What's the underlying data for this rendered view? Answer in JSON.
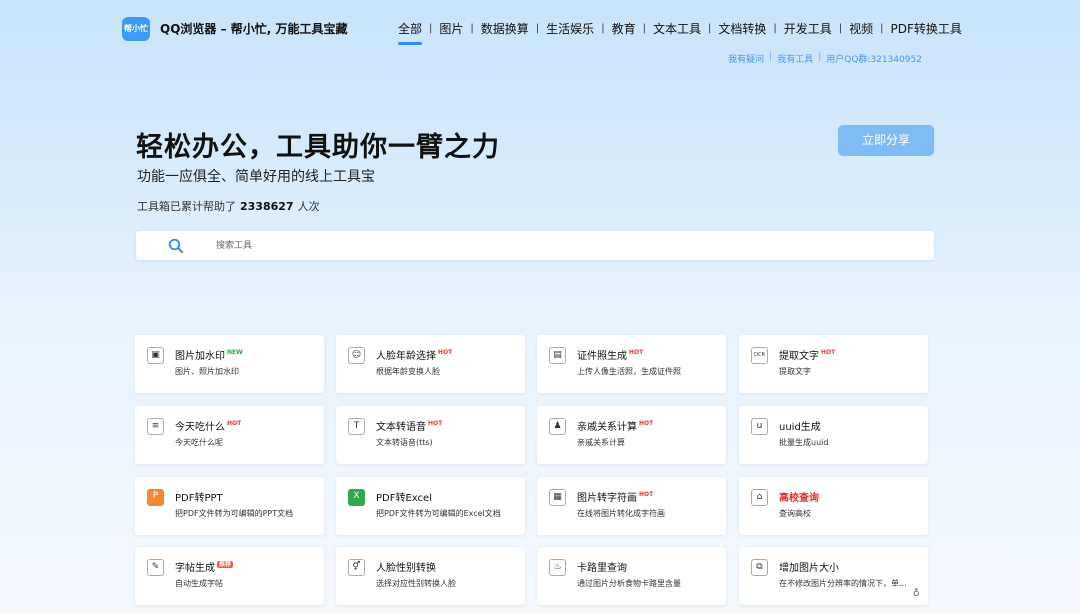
{
  "header": {
    "logo_text": "帮小忙",
    "site_title": "QQ浏览器 – 帮小忙, 万能工具宝藏",
    "nav": [
      "全部",
      "图片",
      "数据换算",
      "生活娱乐",
      "教育",
      "文本工具",
      "文档转换",
      "开发工具",
      "视频",
      "PDF转换工具"
    ],
    "active_nav": "全部",
    "subnav": [
      "我有疑问",
      "我有工具",
      "用户QQ群:321340952"
    ]
  },
  "hero": {
    "title": "轻松办公，工具助你一臂之力",
    "subtitle": "功能一应俱全、简单好用的线上工具宝",
    "count_prefix": "工具箱已累计帮助了",
    "count_value": "2338627",
    "count_suffix": "人次",
    "share_label": "立即分享"
  },
  "search": {
    "placeholder": "搜索工具",
    "icon": "search-icon"
  },
  "colors": {
    "accent": "#2f8cf0",
    "share": "#7ebcf5",
    "hot": "#e23b2e",
    "new": "#19b53a"
  },
  "tools": [
    {
      "title": "图片加水印",
      "badge": "NEW",
      "desc": "图片、照片加水印",
      "icon": "image-icon",
      "glyph": "▣"
    },
    {
      "title": "人脸年龄选择",
      "badge": "HOT",
      "desc": "根据年龄变换人脸",
      "icon": "face-icon",
      "glyph": "☺"
    },
    {
      "title": "证件照生成",
      "badge": "HOT",
      "desc": "上传人像生活照，生成证件照",
      "icon": "id-card-icon",
      "glyph": "▤"
    },
    {
      "title": "提取文字",
      "badge": "HOT",
      "desc": "提取文字",
      "icon": "ocr-icon",
      "glyph": "OCR"
    },
    {
      "title": "今天吃什么",
      "badge": "HOT",
      "desc": "今天吃什么呢",
      "icon": "food-icon",
      "glyph": "≡"
    },
    {
      "title": "文本转语音",
      "badge": "HOT",
      "desc": "文本转语音(tts)",
      "icon": "text-to-speech-icon",
      "glyph": "T"
    },
    {
      "title": "亲戚关系计算",
      "badge": "HOT",
      "desc": "亲戚关系计算",
      "icon": "relatives-icon",
      "glyph": "♟"
    },
    {
      "title": "uuid生成",
      "badge": "",
      "desc": "批量生成uuid",
      "icon": "uuid-icon",
      "glyph": "u"
    },
    {
      "title": "PDF转PPT",
      "badge": "",
      "desc": "把PDF文件转为可编辑的PPT文档",
      "icon": "ppt-icon",
      "glyph": "P"
    },
    {
      "title": "PDF转Excel",
      "badge": "",
      "desc": "把PDF文件转为可编辑的Excel文档",
      "icon": "excel-icon",
      "glyph": "X"
    },
    {
      "title": "图片转字符画",
      "badge": "HOT",
      "desc": "在线将图片转化成字符画",
      "icon": "ascii-art-icon",
      "glyph": "▦"
    },
    {
      "title": "高校查询",
      "badge": "",
      "desc": "查询高校",
      "icon": "university-icon",
      "glyph": "⌂",
      "red": true
    },
    {
      "title": "字帖生成",
      "badge": "TAG",
      "desc": "自动生成字帖",
      "icon": "copybook-icon",
      "glyph": "✎"
    },
    {
      "title": "人脸性别转换",
      "badge": "",
      "desc": "选择对应性别转换人脸",
      "icon": "gender-icon",
      "glyph": "⚥"
    },
    {
      "title": "卡路里查询",
      "badge": "",
      "desc": "通过图片分析食物卡路里含量",
      "icon": "calorie-icon",
      "glyph": "♨"
    },
    {
      "title": "增加图片大小",
      "badge": "",
      "desc": "在不修改图片分辨率的情况下，单...",
      "icon": "resize-image-icon",
      "glyph": "⧉"
    }
  ]
}
